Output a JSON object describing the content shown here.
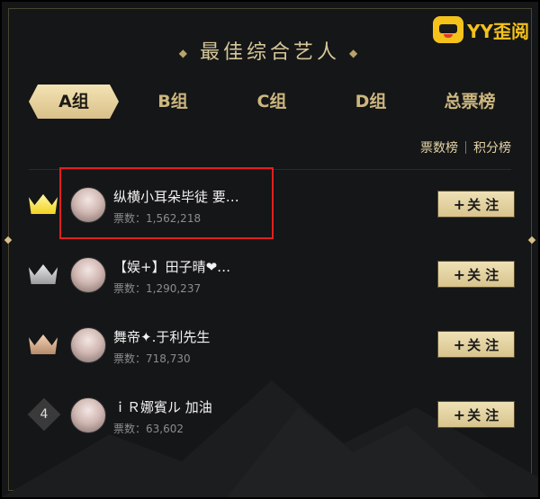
{
  "header": {
    "title": "最佳综合艺人",
    "logo_text": "YY歪阅"
  },
  "tabs": [
    {
      "label": "A组",
      "active": true
    },
    {
      "label": "B组",
      "active": false
    },
    {
      "label": "C组",
      "active": false
    },
    {
      "label": "D组",
      "active": false
    },
    {
      "label": "总票榜",
      "active": false
    }
  ],
  "rank_switch": {
    "votes_label": "票数榜",
    "points_label": "积分榜"
  },
  "rows": [
    {
      "rank_display": "crown-gold",
      "rank": "1",
      "name": "纵横小耳朵毕徒 要…",
      "votes_label": "票数：",
      "votes": "1,562,218",
      "follow_label": "关 注"
    },
    {
      "rank_display": "crown-silver",
      "rank": "2",
      "name": "【娱+】田子晴❤…",
      "votes_label": "票数：",
      "votes": "1,290,237",
      "follow_label": "关 注"
    },
    {
      "rank_display": "crown-bronze",
      "rank": "3",
      "name": "舞帝✦.于利先生",
      "votes_label": "票数：",
      "votes": "718,730",
      "follow_label": "关 注"
    },
    {
      "rank_display": "number",
      "rank": "4",
      "name": "ｉＲ娜賓ル 加油",
      "votes_label": "票数：",
      "votes": "63,602",
      "follow_label": "关 注"
    }
  ],
  "colors": {
    "gold": "#d9c089",
    "highlight": "#e02020",
    "background": "#151617"
  }
}
